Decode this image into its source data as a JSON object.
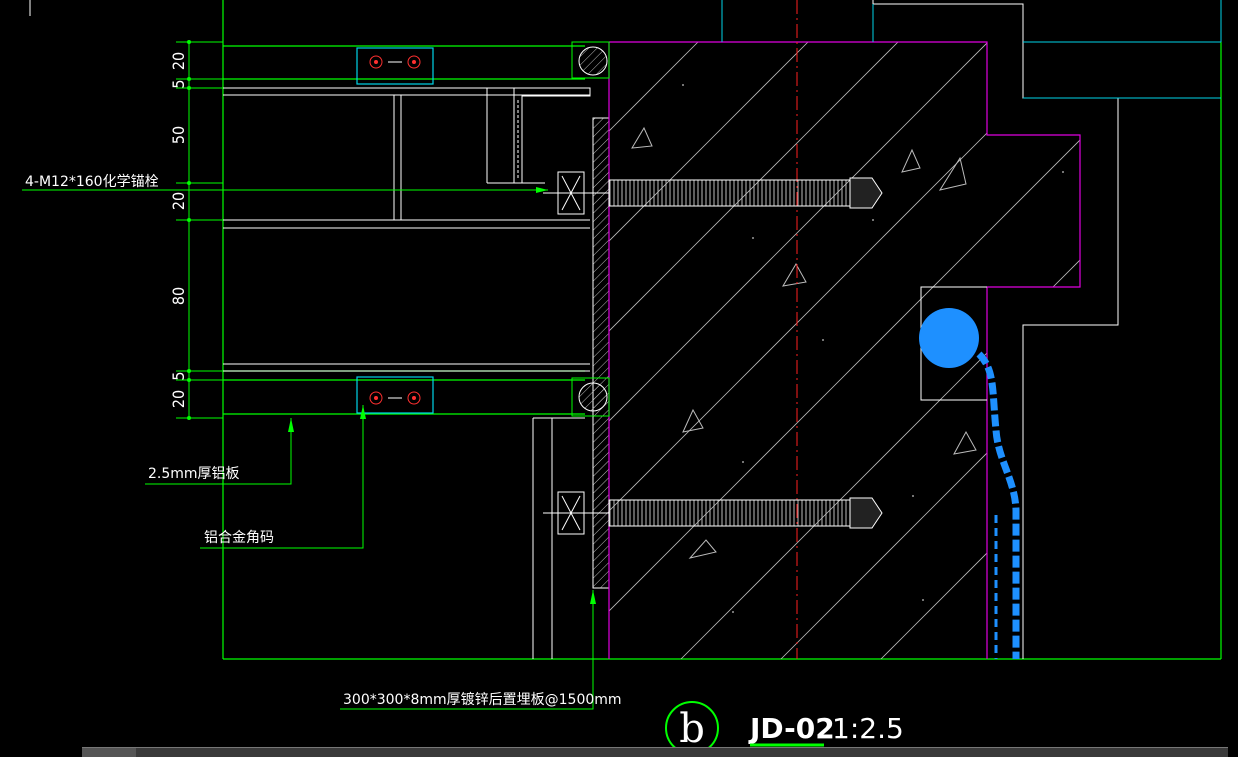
{
  "drawing": {
    "detail_id": "JD-02",
    "scale": "1:2.5",
    "bubble_letter": "b"
  },
  "dimensions": [
    "20",
    "5",
    "50",
    "20",
    "80",
    "5",
    "20"
  ],
  "callouts": {
    "anchor_bolt": "4-M12*160化学锚栓",
    "aluminum_plate": "2.5mm厚铝板",
    "angle_code": "铝合金角码",
    "embed_plate": "300*300*8mm厚镀锌后置埋板@1500mm"
  },
  "colors": {
    "background": "#000000",
    "leader": "#00ff00",
    "outline": "#ffffff",
    "cyan": "#00d5e8",
    "magenta": "#e000e0",
    "centerline": "#ff2020",
    "rod": "#1e90ff",
    "title_underline": "#00ff00"
  }
}
